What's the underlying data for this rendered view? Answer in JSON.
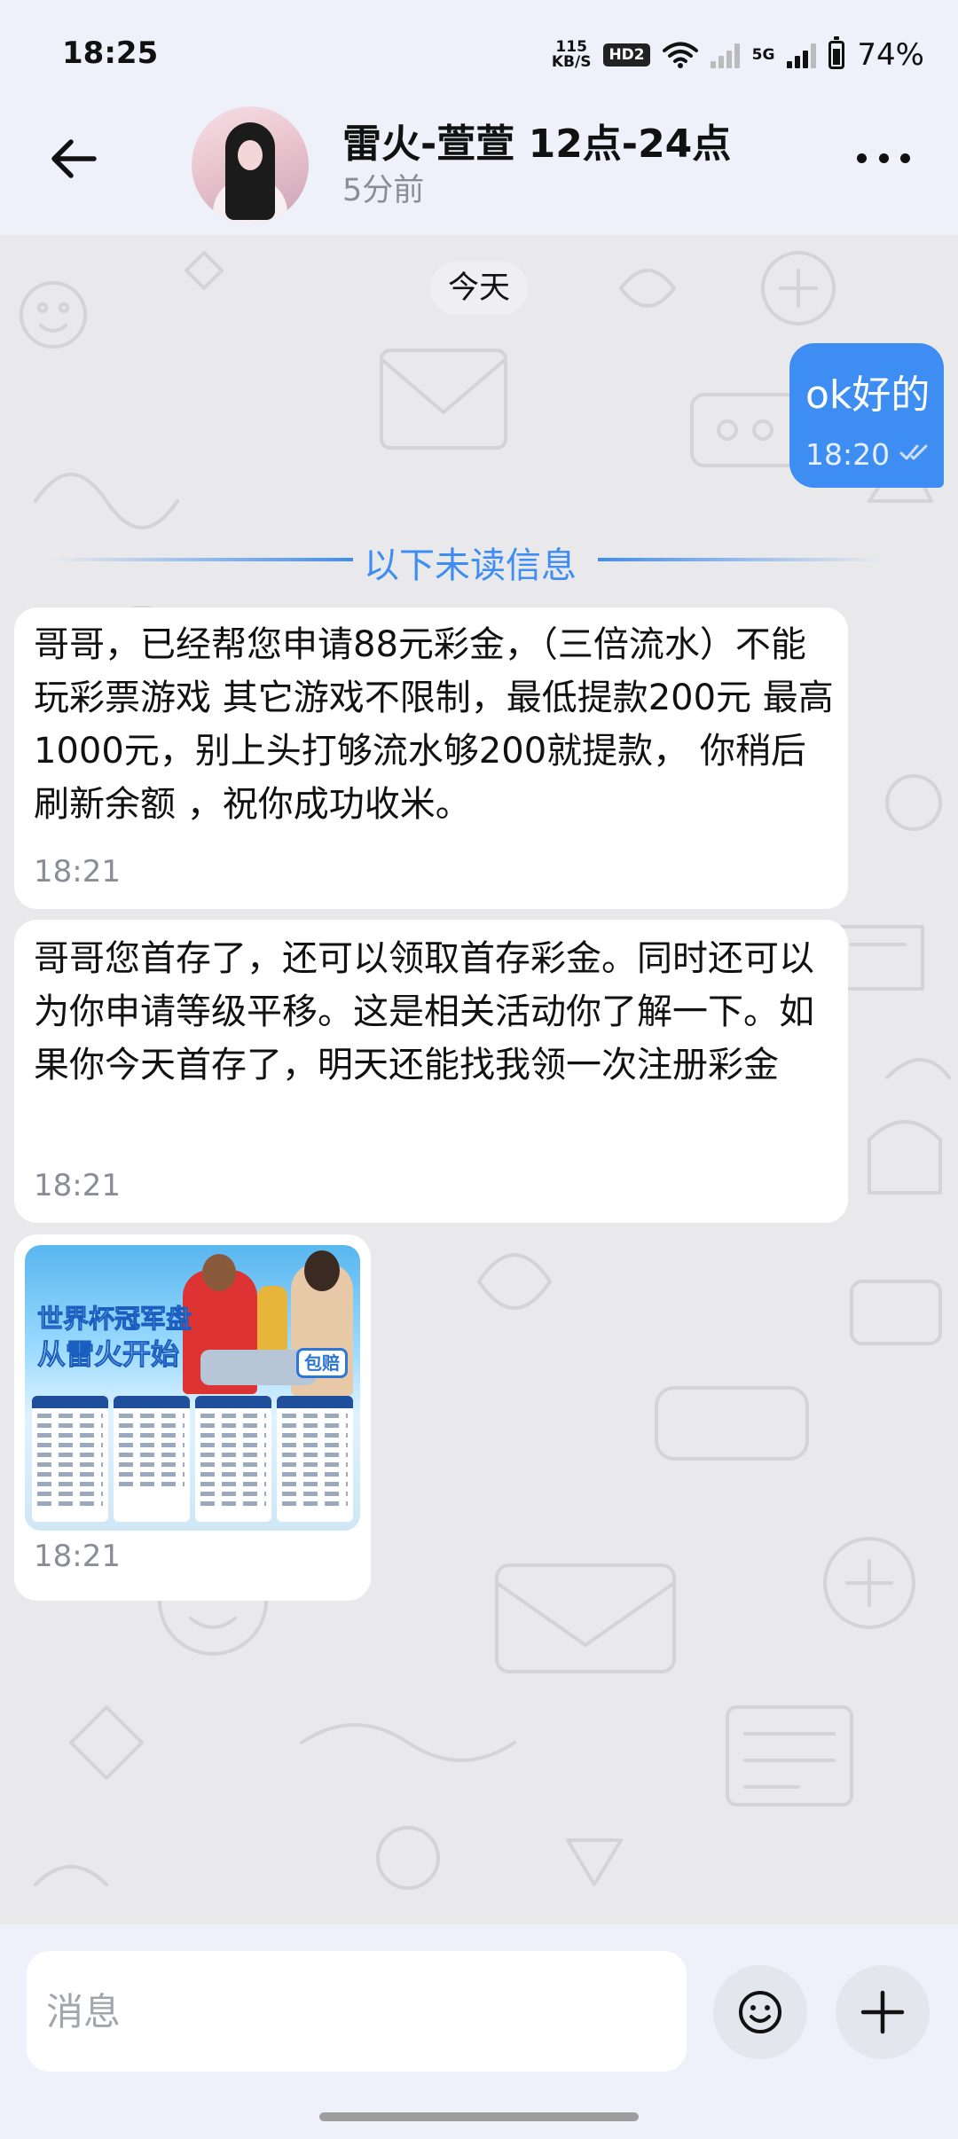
{
  "status_bar": {
    "time": "18:25",
    "speed_value": "115",
    "speed_unit": "KB/S",
    "hd_label": "HD2",
    "network": "5G",
    "battery": "74%",
    "icons": [
      "wifi-icon",
      "signal-icon",
      "battery-icon"
    ]
  },
  "header": {
    "title": "雷火-萱萱 12点-24点",
    "subtitle": "5分前",
    "icons": [
      "back-arrow-icon",
      "more-dots-icon"
    ]
  },
  "chat": {
    "date_label": "今天",
    "unread_label": "以下未读信息",
    "outgoing": {
      "text": "ok好的",
      "time": "18:20",
      "status_icon": "double-check-icon"
    },
    "messages": [
      {
        "text": "哥哥，已经帮您申请88元彩金，（三倍流水）不能玩彩票游戏  其它游戏不限制，最低提款200元  最高1000元，别上头打够流水够200就提款， 你稍后刷新余额 ，祝你成功收米。",
        "time": "18:21"
      },
      {
        "text": "哥哥您首存了，还可以领取首存彩金。同时还可以为你申请等级平移。这是相关活动你了解一下。如果你今天首存了，明天还能找我领一次注册彩金",
        "time": "18:21"
      },
      {
        "image": {
          "headline_1": "世界杯冠军盘",
          "headline_2": "从雷火开始",
          "badge": "包赔"
        },
        "time": "18:21"
      }
    ]
  },
  "composer": {
    "placeholder": "消息",
    "icons": [
      "emoji-icon",
      "plus-icon"
    ]
  },
  "colors": {
    "accent": "#3e8df2",
    "header_bg": "#eef1fa",
    "chat_bg": "#e9e9ec"
  }
}
